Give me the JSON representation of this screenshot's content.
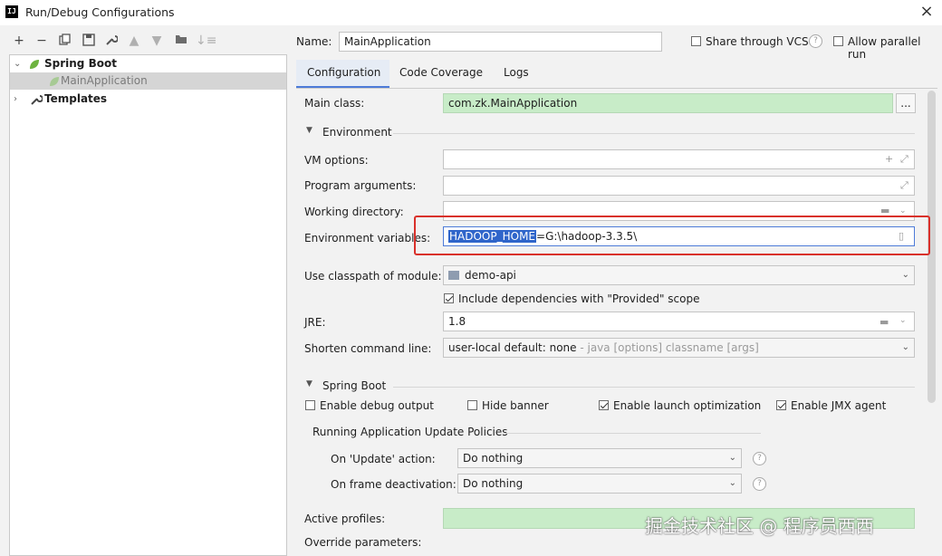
{
  "window": {
    "title": "Run/Debug Configurations",
    "logo": "IJ"
  },
  "toolbar": [
    "add-icon",
    "remove-icon",
    "copy-icon",
    "save-icon",
    "wrench-icon",
    "move-up-icon",
    "move-down-icon",
    "folder-icon",
    "sort-icon"
  ],
  "tree": {
    "group": "Spring Boot",
    "child": "MainApplication",
    "templates": "Templates"
  },
  "config": {
    "name_label": "Name:",
    "name_value": "MainApplication",
    "share_label": "Share through VCS",
    "parallel_label": "Allow parallel run",
    "help": "?",
    "tabs": [
      "Configuration",
      "Code Coverage",
      "Logs"
    ],
    "main_class_label": "Main class:",
    "main_class_value": "com.zk.MainApplication",
    "browse": "...",
    "env_section": "Environment",
    "vm_label": "VM options:",
    "args_label": "Program arguments:",
    "workdir_label": "Working directory:",
    "envvars_label": "Environment variables:",
    "envvar_key": "HADOOP_HOME",
    "envvar_rest": "=G:\\hadoop-3.3.5\\",
    "classpath_label": "Use classpath of module:",
    "module_value": "demo-api",
    "include_deps": "Include dependencies with \"Provided\" scope",
    "jre_label": "JRE:",
    "jre_value": "1.8",
    "shorten_label": "Shorten command line:",
    "shorten_value": "user-local default: none",
    "shorten_hint": " - java [options] classname [args]",
    "spring_section": "Spring Boot",
    "debug_output": "Enable debug output",
    "hide_banner": "Hide banner",
    "launch_opt": "Enable launch optimization",
    "jmx": "Enable JMX agent",
    "update_policies": "Running Application Update Policies",
    "update_action_label": "On 'Update' action:",
    "update_action_value": "Do nothing",
    "frame_label": "On frame deactivation:",
    "frame_value": "Do nothing",
    "profiles_label": "Active profiles:",
    "override_label": "Override parameters:"
  },
  "watermark": "掘金技术社区 @ 程序员西西",
  "colors": {
    "highlight": "#d9312b",
    "selection": "#2f65ca",
    "green_field": "#c8ecc8"
  }
}
